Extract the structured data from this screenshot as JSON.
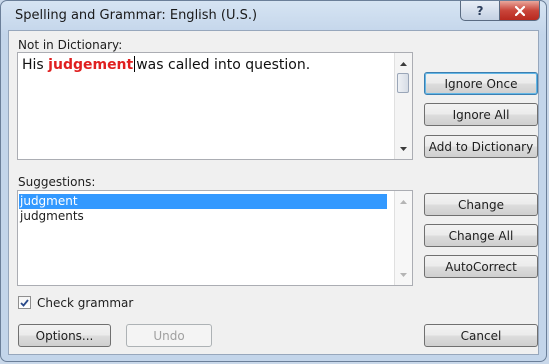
{
  "window": {
    "title": "Spelling and Grammar: English (U.S.)",
    "help_glyph": "?",
    "close_glyph": "X"
  },
  "not_in_dictionary": {
    "label": "Not in Dictionary:",
    "sentence_before": "His ",
    "flagged_word": "judgement",
    "sentence_after": "was called into question."
  },
  "suggestions": {
    "label": "Suggestions:",
    "items": [
      "judgment",
      "judgments"
    ],
    "selected_index": 0
  },
  "buttons": {
    "ignore_once": "Ignore Once",
    "ignore_all": "Ignore All",
    "add_to_dictionary": "Add to Dictionary",
    "change": "Change",
    "change_all": "Change All",
    "autocorrect": "AutoCorrect",
    "options": "Options...",
    "undo": "Undo",
    "cancel": "Cancel"
  },
  "check_grammar": {
    "label": "Check grammar",
    "checked": true
  },
  "colors": {
    "flagged_word": "#e02020",
    "selection": "#3399ff"
  }
}
